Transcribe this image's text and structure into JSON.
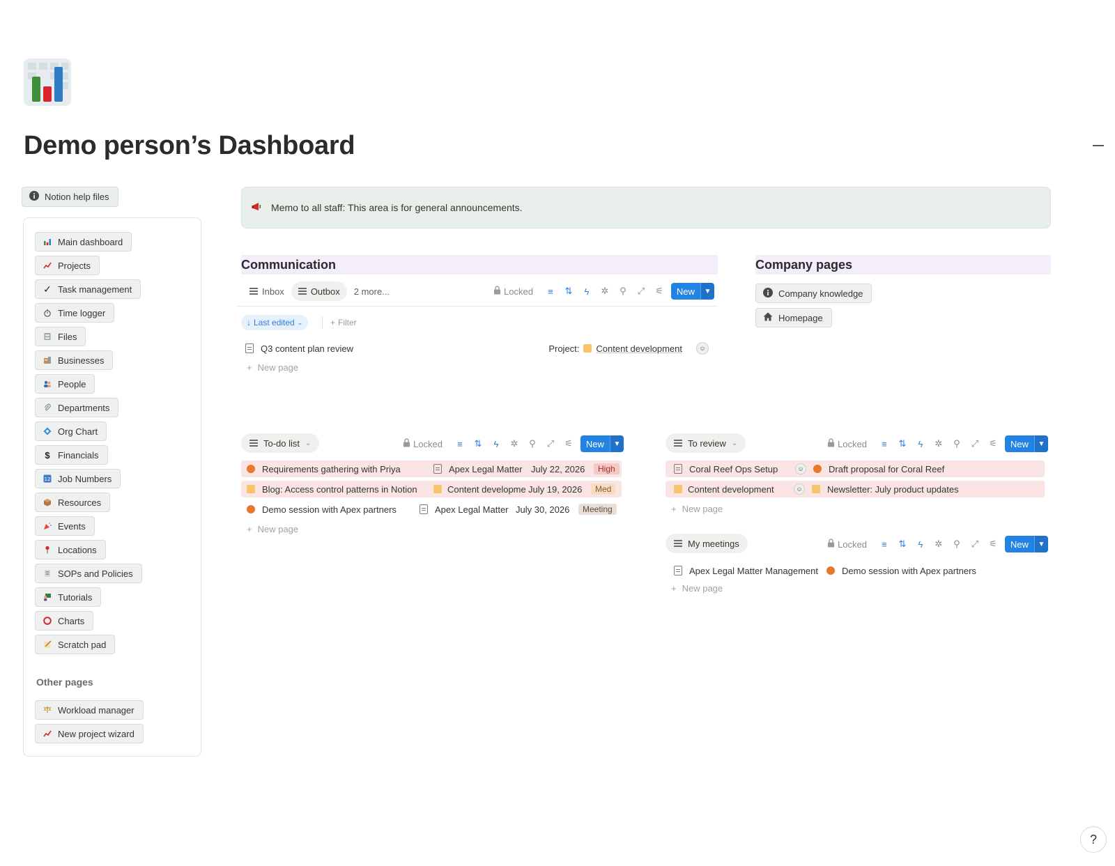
{
  "page": {
    "title": "Demo person’s Dashboard",
    "icon": "bar-chart-icon"
  },
  "help": {
    "label": "Notion help files",
    "icon": "info-icon"
  },
  "nav": {
    "items": [
      {
        "label": "Main dashboard",
        "icon": "bar-chart-icon"
      },
      {
        "label": "Projects",
        "icon": "trend-chart-icon"
      },
      {
        "label": "Task management",
        "icon": "checkmark-icon"
      },
      {
        "label": "Time logger",
        "icon": "stopwatch-icon"
      },
      {
        "label": "Files",
        "icon": "cabinet-icon"
      },
      {
        "label": "Businesses",
        "icon": "building-icon"
      },
      {
        "label": "People",
        "icon": "people-icon"
      },
      {
        "label": "Departments",
        "icon": "paperclip-icon"
      },
      {
        "label": "Org Chart",
        "icon": "diamond-icon"
      },
      {
        "label": "Financials",
        "icon": "dollar-icon"
      },
      {
        "label": "Job Numbers",
        "icon": "numbers-icon"
      },
      {
        "label": "Resources",
        "icon": "box-icon"
      },
      {
        "label": "Events",
        "icon": "party-icon"
      },
      {
        "label": "Locations",
        "icon": "pin-icon"
      },
      {
        "label": "SOPs and Policies",
        "icon": "document-icon"
      },
      {
        "label": "Tutorials",
        "icon": "teacher-icon"
      },
      {
        "label": "Charts",
        "icon": "circle-icon"
      },
      {
        "label": "Scratch pad",
        "icon": "memo-icon"
      }
    ],
    "other_heading": "Other pages",
    "other_items": [
      {
        "label": "Workload manager",
        "icon": "scale-icon"
      },
      {
        "label": "New project wizard",
        "icon": "trend-chart-icon"
      }
    ]
  },
  "announcement": {
    "text": "Memo to all staff: This area is for general announcements.",
    "icon": "megaphone-icon"
  },
  "communication": {
    "heading": "Communication",
    "tabs": [
      {
        "label": "Inbox"
      },
      {
        "label": "Outbox"
      },
      {
        "label": "2 more..."
      }
    ],
    "locked": "Locked",
    "new": "New",
    "sort_label": "Last edited",
    "filter_label": "Filter",
    "rows": [
      {
        "title": "Q3 content plan review",
        "project_label": "Project:",
        "project": "Content development"
      }
    ],
    "new_page": "New page"
  },
  "company": {
    "heading": "Company pages",
    "buttons": [
      {
        "label": "Company knowledge",
        "icon": "info-icon"
      },
      {
        "label": "Homepage",
        "icon": "home-icon"
      }
    ]
  },
  "todo": {
    "view": "To-do list",
    "locked": "Locked",
    "new": "New",
    "rows": [
      {
        "title": "Requirements gathering with Priya",
        "project": "Apex Legal Matter",
        "date": "July 22, 2026",
        "tag": "High"
      },
      {
        "title": "Blog: Access control patterns in Notion",
        "project": "Content developme",
        "date": "July 19, 2026",
        "tag": "Med"
      },
      {
        "title": "Demo session with Apex partners",
        "project": "Apex Legal Matter",
        "date": "July 30, 2026",
        "tag": "Meeting"
      }
    ],
    "new_page": "New page"
  },
  "review": {
    "view": "To review",
    "locked": "Locked",
    "new": "New",
    "rows": [
      {
        "title": "Coral Reef Ops Setup",
        "task": "Draft proposal for Coral Reef"
      },
      {
        "title": "Content development",
        "task": "Newsletter: July product updates"
      }
    ],
    "new_page": "New page"
  },
  "meetings": {
    "view": "My meetings",
    "locked": "Locked",
    "new": "New",
    "rows": [
      {
        "title": "Apex Legal Matter Management",
        "task": "Demo session with Apex partners"
      }
    ],
    "new_page": "New page"
  }
}
